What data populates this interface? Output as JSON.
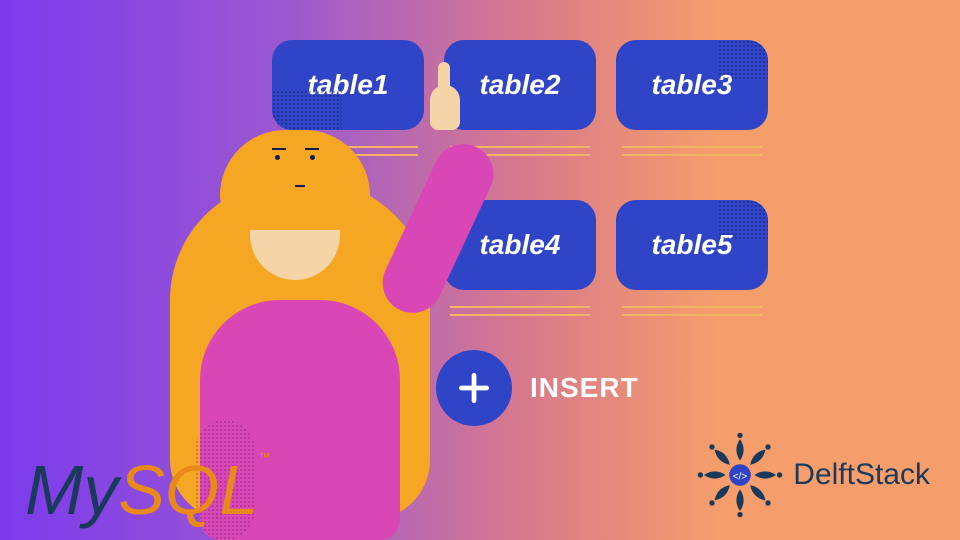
{
  "tables": [
    "table1",
    "table2",
    "table3",
    "table4",
    "table5"
  ],
  "action": {
    "label": "INSERT"
  },
  "logos": {
    "mysql_my": "My",
    "mysql_sql": "SQL",
    "mysql_tm": "™",
    "delft": "DelftStack"
  },
  "icons": {
    "plus": "plus-icon",
    "mandala": "delftstack-logo"
  }
}
